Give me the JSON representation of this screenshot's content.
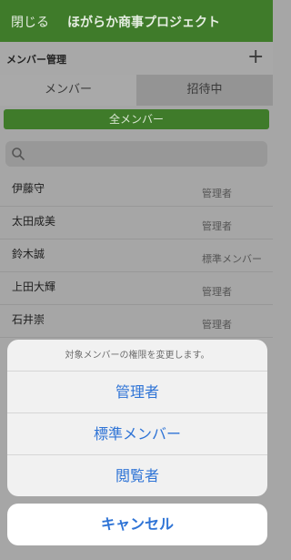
{
  "header": {
    "close_label": "閉じる",
    "title": "ほがらか商事プロジェクト"
  },
  "subheader": {
    "label": "メンバー管理",
    "add_symbol": "+"
  },
  "tabs": [
    {
      "label": "メンバー"
    },
    {
      "label": "招待中"
    }
  ],
  "all_members_label": "全メンバー",
  "members": [
    {
      "name": "伊藤守",
      "role": "管理者"
    },
    {
      "name": "太田成美",
      "role": "管理者"
    },
    {
      "name": "鈴木誠",
      "role": "標準メンバー"
    },
    {
      "name": "上田大輝",
      "role": "管理者"
    },
    {
      "name": "石井崇",
      "role": "管理者"
    }
  ],
  "action_sheet": {
    "message": "対象メンバーの権限を変更します。",
    "options": [
      {
        "label": "管理者"
      },
      {
        "label": "標準メンバー"
      },
      {
        "label": "閲覧者"
      }
    ],
    "cancel_label": "キャンセル"
  }
}
